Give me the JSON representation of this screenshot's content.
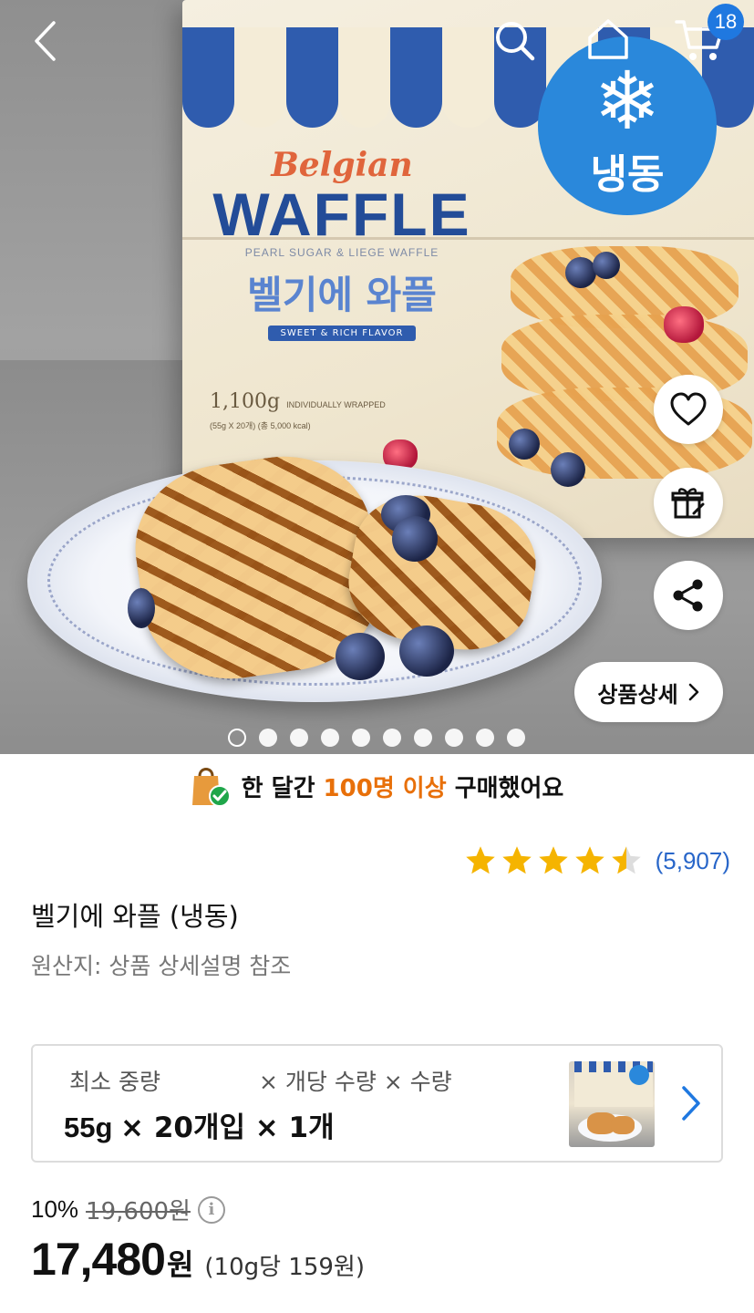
{
  "header": {
    "cart_count": "18"
  },
  "hero": {
    "frozen_badge": "냉동",
    "box_text": {
      "belgian": "Belgian",
      "waffle": "WAFFLE",
      "pearl": "PEARL SUGAR & LIEGE WAFFLE",
      "korean": "벨기에 와플",
      "ribbon": "SWEET & RICH FLAVOR",
      "weight": "1,100g",
      "wrapped": "INDIVIDUALLY WRAPPED",
      "sub": "(55g X 20개) (총 5,000 kcal)"
    },
    "detail_button": "상품상세",
    "carousel": {
      "total": 10,
      "active_index": 0
    }
  },
  "purchase_banner": {
    "prefix": "한 달간",
    "highlight": "100명 이상",
    "suffix": "구매했어요"
  },
  "rating": {
    "stars": 4.5,
    "count": "(5,907)"
  },
  "product": {
    "name": "벨기에 와플 (냉동)",
    "origin": "원산지: 상품 상세설명 참조"
  },
  "option": {
    "header_1": "최소 중량",
    "header_2": "× 개당 수량 × 수량",
    "value_weight": "55g",
    "value_rest": "× 20개입 × 1개"
  },
  "price": {
    "discount_rate": "10%",
    "original": "19,600원",
    "sale": "17,480",
    "currency": "원",
    "unit": "(10g당 159원)"
  },
  "colors": {
    "accent_blue": "#1f78e0",
    "highlight_orange": "#e8700a",
    "star": "#f5b400",
    "rating_count": "#2866c9"
  },
  "icons": [
    "back-icon",
    "search-icon",
    "home-icon",
    "cart-icon",
    "heart-icon",
    "gift-icon",
    "share-icon",
    "chevron-right-icon",
    "shopping-bag-check-icon",
    "star-icon",
    "info-icon"
  ]
}
